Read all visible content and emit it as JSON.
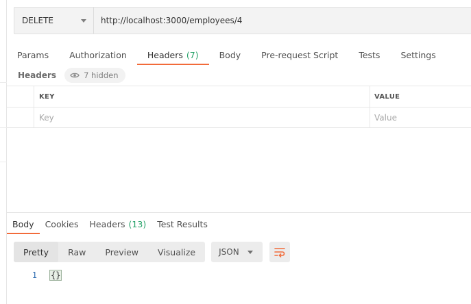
{
  "request": {
    "method": "DELETE",
    "url": "http://localhost:3000/employees/4"
  },
  "request_tabs": [
    {
      "label": "Params"
    },
    {
      "label": "Authorization"
    },
    {
      "label": "Headers",
      "count": "(7)"
    },
    {
      "label": "Body"
    },
    {
      "label": "Pre-request Script"
    },
    {
      "label": "Tests"
    },
    {
      "label": "Settings"
    }
  ],
  "headers_panel": {
    "title": "Headers",
    "hidden_label": "7 hidden",
    "columns": {
      "key": "KEY",
      "value": "VALUE"
    },
    "placeholders": {
      "key": "Key",
      "value": "Value"
    }
  },
  "response_tabs": [
    {
      "label": "Body"
    },
    {
      "label": "Cookies"
    },
    {
      "label": "Headers",
      "count": "(13)"
    },
    {
      "label": "Test Results"
    }
  ],
  "view_modes": [
    "Pretty",
    "Raw",
    "Preview",
    "Visualize"
  ],
  "format": "JSON",
  "response_body": {
    "line_number": "1",
    "content": "{}"
  },
  "colors": {
    "accent": "#f26b3a",
    "count_green": "#26a269"
  },
  "icons": {
    "hidden": "eye-icon",
    "wrap": "wrap-lines-icon",
    "dropdown": "chevron-down-icon"
  }
}
